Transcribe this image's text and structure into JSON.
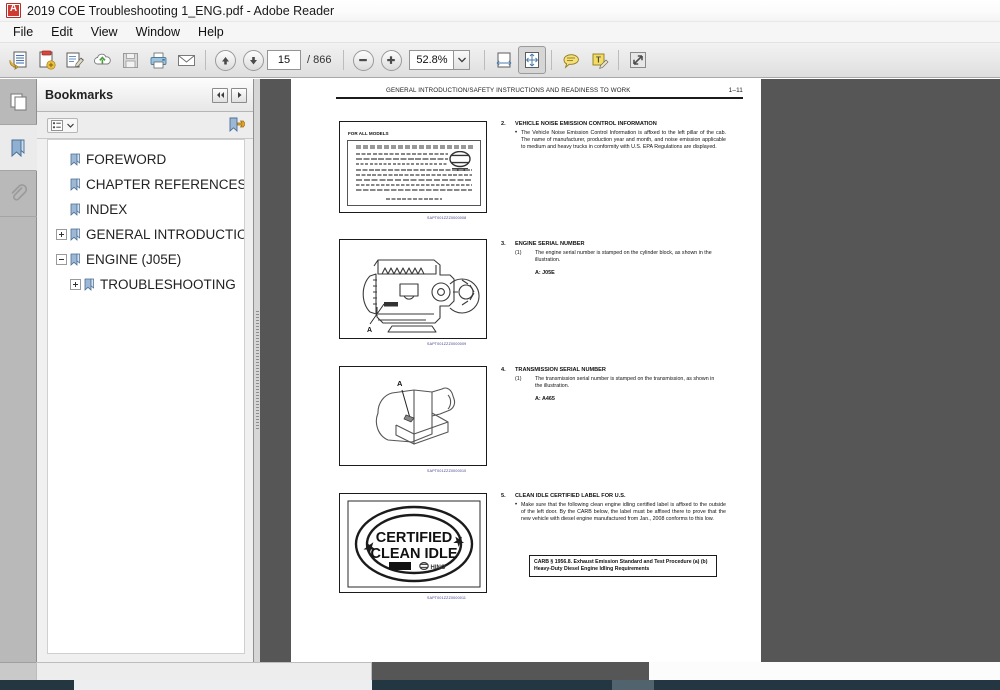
{
  "window": {
    "title": "2019 COE Troubleshooting 1_ENG.pdf - Adobe Reader",
    "app_icon": "pdf-document-icon"
  },
  "menubar": {
    "items": [
      {
        "label": "File",
        "name": "menu-file"
      },
      {
        "label": "Edit",
        "name": "menu-edit"
      },
      {
        "label": "View",
        "name": "menu-view"
      },
      {
        "label": "Window",
        "name": "menu-window"
      },
      {
        "label": "Help",
        "name": "menu-help"
      }
    ]
  },
  "toolbar": {
    "buttons": [
      {
        "name": "open-file-icon",
        "label": "Open"
      },
      {
        "name": "create-pdf-icon",
        "label": "Create PDF"
      },
      {
        "name": "edit-pdf-icon",
        "label": "Edit PDF"
      },
      {
        "name": "upload-cloud-icon",
        "label": "Upload to Cloud"
      },
      {
        "name": "save-icon",
        "label": "Save"
      },
      {
        "name": "print-icon",
        "label": "Print"
      },
      {
        "name": "email-icon",
        "label": "Email"
      }
    ],
    "previous_page_label": "Previous Page",
    "next_page_label": "Next Page",
    "page_number": "15",
    "page_total": "/ 866",
    "zoom_out_label": "Zoom Out",
    "zoom_in_label": "Zoom In",
    "zoom_value": "52.8%",
    "zoom_dropdown_label": "Zoom Presets",
    "right_buttons": [
      {
        "name": "fit-width-icon",
        "label": "Fit Width"
      },
      {
        "name": "fit-page-icon",
        "label": "Fit Page"
      },
      {
        "name": "comment-icon",
        "label": "Comment"
      },
      {
        "name": "text-markup-icon",
        "label": "Add Text Comment"
      },
      {
        "name": "fullscreen-icon",
        "label": "Read Mode"
      }
    ]
  },
  "rail": {
    "items": [
      {
        "name": "page-thumbnails-icon",
        "label": "Page Thumbnails",
        "active": false
      },
      {
        "name": "bookmarks-icon",
        "label": "Bookmarks",
        "active": true
      },
      {
        "name": "attachments-icon",
        "label": "Attachments",
        "active": false
      }
    ]
  },
  "bookmarks_panel": {
    "title": "Bookmarks",
    "collapse_label": "Collapse Panel",
    "expand_label": "Expand Panel",
    "options_label": "Options",
    "highlight_label": "Highlight Current Bookmark",
    "items": [
      {
        "label": "FOREWORD",
        "expander": "none",
        "indent": 0,
        "name": "bookmark-foreword"
      },
      {
        "label": "CHAPTER REFERENCES",
        "expander": "none",
        "indent": 0,
        "name": "bookmark-chapter-references"
      },
      {
        "label": "INDEX",
        "expander": "none",
        "indent": 0,
        "name": "bookmark-index"
      },
      {
        "label": "GENERAL INTRODUCTION",
        "expander": "plus",
        "indent": 0,
        "name": "bookmark-general-introduction"
      },
      {
        "label": "ENGINE (J05E)",
        "expander": "minus",
        "indent": 0,
        "name": "bookmark-engine-j05e"
      },
      {
        "label": "TROUBLESHOOTING",
        "expander": "plus",
        "indent": 1,
        "name": "bookmark-troubleshooting"
      }
    ]
  },
  "document": {
    "header_title": "GENERAL INTRODUCTION/SAFETY INSTRUCTIONS AND READINESS TO WORK",
    "header_page": "1–11",
    "sections": [
      {
        "number": "2.",
        "title": "VEHICLE NOISE EMISSION CONTROL INFORMATION",
        "bullet": "•",
        "body": "The Vehicle Noise Emission Control Information is affixed to the left pillar of the cab. The name of manufacturer, production year and month, and noise emission applicable to medium and heavy trucks in conformity with U.S. EPA Regulations are displayed."
      },
      {
        "number": "3.",
        "title": "ENGINE SERIAL NUMBER",
        "sub": "(1)",
        "body": "The engine serial number is stamped on the cylinder block, as shown in the illustration.",
        "value": "A: J05E"
      },
      {
        "number": "4.",
        "title": "TRANSMISSION SERIAL NUMBER",
        "sub": "(1)",
        "body": "The transmission serial number is stamped on the transmission, as shown in the illustration.",
        "value": "A: A465"
      },
      {
        "number": "5.",
        "title": "CLEAN IDLE CERTIFIED LABEL FOR U.S.",
        "bullet": "•",
        "body": "Make sure that the following clean engine idling certified label is affixed to the outside of the left door. By the CARB below, the label must be affixed there to prove that the new vehicle with diesel engine manufactured from Jan., 2008 conforms to this low.",
        "carb_note": "CARB § 1956.8. Exhaust Emission Standard and Test Procedure (a) (b) Heavy-Duty Diesel Engine Idling Requirements"
      }
    ],
    "figures": [
      {
        "name": "figure-noise-emission-label",
        "caption_label": "FOR ALL MODELS",
        "code": "SAPT001ZZZ0000008"
      },
      {
        "name": "figure-engine-serial-number",
        "callout": "A",
        "code": "SAPT001ZZZ0000009"
      },
      {
        "name": "figure-transmission-serial-number",
        "callout": "A",
        "code": "SAPT001ZZZ0000010"
      },
      {
        "name": "figure-clean-idle-label",
        "label_line1": "CERTIFIED",
        "label_line2": "CLEAN IDLE",
        "brand": "HINO",
        "code": "SAPT001ZZZ0000011"
      }
    ]
  },
  "colors": {
    "viewport_background": "#565656",
    "page_background": "#ffffff",
    "toolbar_background": "#e9e9e9",
    "panel_background": "#f0f0f0",
    "taskbar": "#243642",
    "bookmark_icon": "#7d9cc0"
  }
}
